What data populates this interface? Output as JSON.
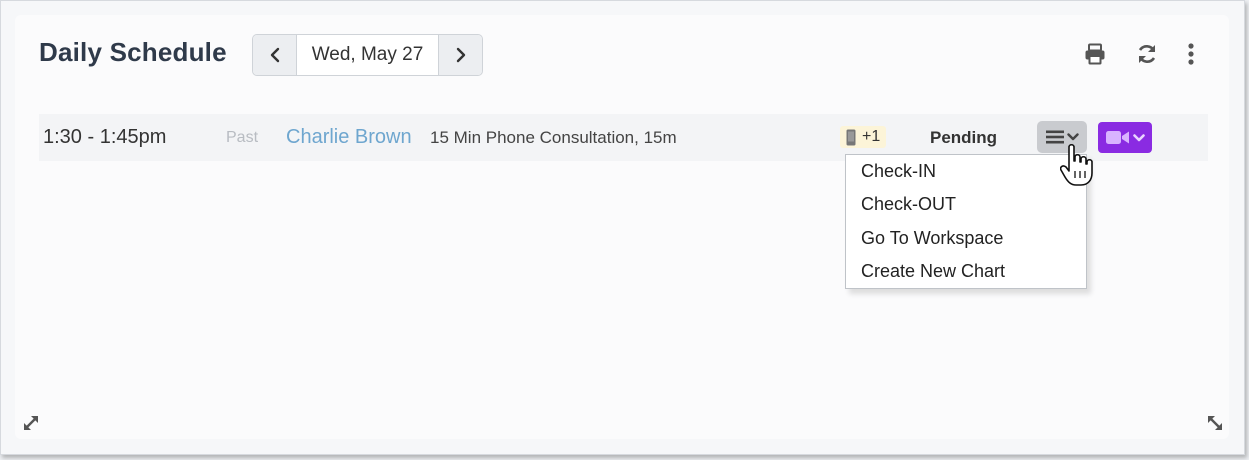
{
  "header": {
    "title": "Daily Schedule",
    "date": "Wed, May 27",
    "prev_icon": "chevron-left-icon",
    "next_icon": "chevron-right-icon",
    "toolbar_icons": [
      "print-icon",
      "refresh-icon",
      "more-vertical-icon"
    ]
  },
  "appointment": {
    "time": "1:30 - 1:45pm",
    "state": "Past",
    "patient": "Charlie Brown",
    "service": "15 Min Phone Consultation, 15m",
    "phone_extra": "+1",
    "status": "Pending",
    "colors": {
      "patient_link": "#6ea6cf",
      "video_button": "#8a2be2",
      "phone_badge_bg": "#fcf4d8"
    }
  },
  "menu": {
    "items": [
      "Check-IN",
      "Check-OUT",
      "Go To Workspace",
      "Create New Chart"
    ]
  }
}
